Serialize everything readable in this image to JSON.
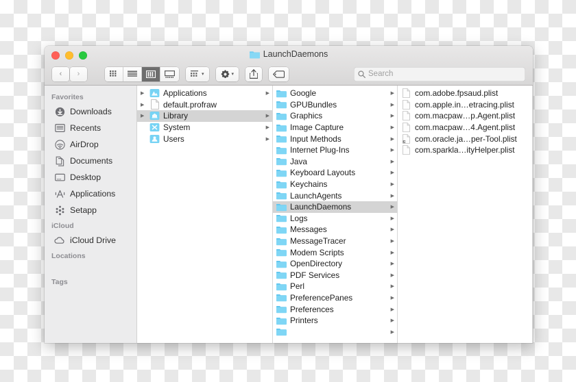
{
  "window": {
    "title": "LaunchDaemons",
    "title_icon": "folder-icon",
    "traffic_lights": {
      "close": "close-button",
      "minimize": "minimize-button",
      "maximize": "maximize-button"
    }
  },
  "toolbar": {
    "back_label": "‹",
    "forward_label": "›",
    "view_modes": [
      {
        "name": "icon-view",
        "icon": "grid-icon",
        "active": false
      },
      {
        "name": "list-view",
        "icon": "list-icon",
        "active": false
      },
      {
        "name": "column-view",
        "icon": "columns-icon",
        "active": true
      },
      {
        "name": "gallery-view",
        "icon": "gallery-icon",
        "active": false
      }
    ],
    "group_button": {
      "name": "arrange-button",
      "icon": "group-grid-icon",
      "chevron": "▾"
    },
    "action_button": {
      "name": "action-button",
      "icon": "gear-icon",
      "chevron": "▾"
    },
    "share_button": {
      "name": "share-button",
      "icon": "share-icon"
    },
    "tag_button": {
      "name": "tag-button",
      "icon": "tag-icon"
    }
  },
  "search": {
    "icon": "search-icon",
    "placeholder": "Search",
    "value": ""
  },
  "sidebar": {
    "sections": [
      {
        "header": "Favorites",
        "items": [
          {
            "label": "Downloads",
            "icon": "download-icon"
          },
          {
            "label": "Recents",
            "icon": "clock-icon"
          },
          {
            "label": "AirDrop",
            "icon": "airdrop-icon"
          },
          {
            "label": "Documents",
            "icon": "documents-icon"
          },
          {
            "label": "Desktop",
            "icon": "desktop-icon"
          },
          {
            "label": "Applications",
            "icon": "applications-icon"
          },
          {
            "label": "Setapp",
            "icon": "setapp-icon"
          }
        ]
      },
      {
        "header": "iCloud",
        "items": [
          {
            "label": "iCloud Drive",
            "icon": "cloud-icon"
          }
        ]
      },
      {
        "header": "Locations",
        "items": []
      },
      {
        "header": "Tags",
        "items": []
      }
    ]
  },
  "columns": [
    {
      "name": "column-root",
      "items": [
        {
          "label": "Applications",
          "icon": "applications-folder-icon",
          "has_children": true,
          "disclosure": true,
          "selected": false
        },
        {
          "label": "default.profraw",
          "icon": "file-icon",
          "has_children": false,
          "disclosure": true,
          "selected": false
        },
        {
          "label": "Library",
          "icon": "library-folder-icon",
          "has_children": true,
          "disclosure": true,
          "selected": true
        },
        {
          "label": "System",
          "icon": "system-folder-icon",
          "has_children": true,
          "disclosure": false,
          "selected": false
        },
        {
          "label": "Users",
          "icon": "users-folder-icon",
          "has_children": true,
          "disclosure": false,
          "selected": false
        }
      ]
    },
    {
      "name": "column-library",
      "items": [
        {
          "label": "Google",
          "icon": "folder-icon",
          "has_children": true,
          "selected": false
        },
        {
          "label": "GPUBundles",
          "icon": "folder-icon",
          "has_children": true,
          "selected": false
        },
        {
          "label": "Graphics",
          "icon": "folder-icon",
          "has_children": true,
          "selected": false
        },
        {
          "label": "Image Capture",
          "icon": "folder-icon",
          "has_children": true,
          "selected": false
        },
        {
          "label": "Input Methods",
          "icon": "folder-icon",
          "has_children": true,
          "selected": false
        },
        {
          "label": "Internet Plug-Ins",
          "icon": "folder-icon",
          "has_children": true,
          "selected": false
        },
        {
          "label": "Java",
          "icon": "folder-icon",
          "has_children": true,
          "selected": false
        },
        {
          "label": "Keyboard Layouts",
          "icon": "folder-icon",
          "has_children": true,
          "selected": false
        },
        {
          "label": "Keychains",
          "icon": "folder-icon",
          "has_children": true,
          "selected": false
        },
        {
          "label": "LaunchAgents",
          "icon": "folder-icon",
          "has_children": true,
          "selected": false
        },
        {
          "label": "LaunchDaemons",
          "icon": "folder-icon",
          "has_children": true,
          "selected": true
        },
        {
          "label": "Logs",
          "icon": "folder-icon",
          "has_children": true,
          "selected": false
        },
        {
          "label": "Messages",
          "icon": "folder-icon",
          "has_children": true,
          "selected": false
        },
        {
          "label": "MessageTracer",
          "icon": "folder-icon",
          "has_children": true,
          "selected": false
        },
        {
          "label": "Modem Scripts",
          "icon": "folder-icon",
          "has_children": true,
          "selected": false
        },
        {
          "label": "OpenDirectory",
          "icon": "folder-icon",
          "has_children": true,
          "selected": false
        },
        {
          "label": "PDF Services",
          "icon": "folder-icon",
          "has_children": true,
          "selected": false
        },
        {
          "label": "Perl",
          "icon": "folder-icon",
          "has_children": true,
          "selected": false
        },
        {
          "label": "PreferencePanes",
          "icon": "folder-icon",
          "has_children": true,
          "selected": false
        },
        {
          "label": "Preferences",
          "icon": "folder-icon",
          "has_children": true,
          "selected": false
        },
        {
          "label": "Printers",
          "icon": "folder-icon",
          "has_children": true,
          "selected": false
        },
        {
          "label": "",
          "icon": "folder-icon",
          "has_children": true,
          "selected": false
        }
      ]
    },
    {
      "name": "column-launchdaemons",
      "items": [
        {
          "label": "com.adobe.fpsaud.plist",
          "icon": "file-icon",
          "has_children": false,
          "selected": false
        },
        {
          "label": "com.apple.in…etracing.plist",
          "icon": "file-icon",
          "has_children": false,
          "selected": false
        },
        {
          "label": "com.macpaw…p.Agent.plist",
          "icon": "file-icon",
          "has_children": false,
          "selected": false
        },
        {
          "label": "com.macpaw…4.Agent.plist",
          "icon": "file-icon",
          "has_children": false,
          "selected": false
        },
        {
          "label": "com.oracle.ja…per-Tool.plist",
          "icon": "file-alias-icon",
          "has_children": false,
          "selected": false
        },
        {
          "label": "com.sparkla…ityHelper.plist",
          "icon": "file-icon",
          "has_children": false,
          "selected": false
        }
      ]
    }
  ],
  "colors": {
    "folder_blue": "#6fcdf2",
    "selection_gray": "#d4d4d4",
    "sidebar_bg": "#ececed",
    "titlebar_top": "#e9e8e8",
    "titlebar_bottom": "#d8d7d7",
    "close_red": "#ff5f57",
    "minimize_yellow": "#ffbd2e",
    "maximize_green": "#28c940"
  }
}
